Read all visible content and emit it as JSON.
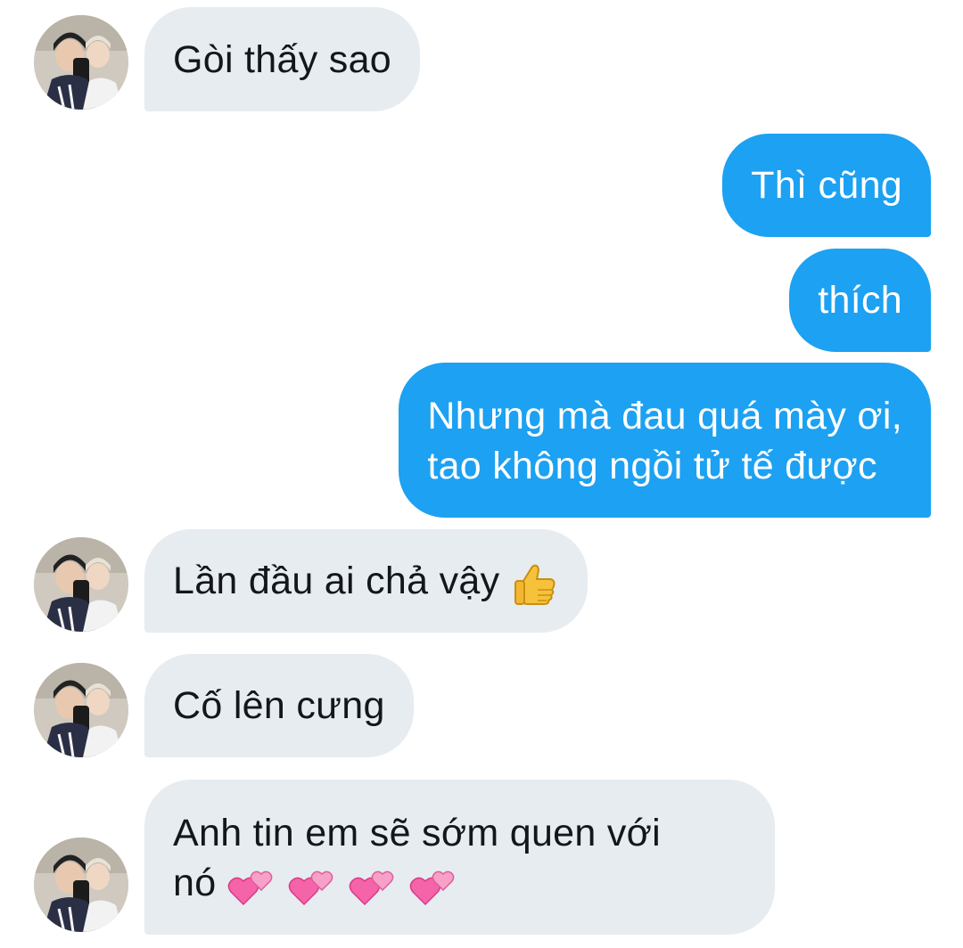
{
  "colors": {
    "incoming_bubble": "#e6ecf0",
    "outgoing_bubble": "#1da1f2",
    "incoming_text": "#14171a",
    "outgoing_text": "#ffffff"
  },
  "messages": [
    {
      "direction": "incoming",
      "text": "Gòi thấy sao",
      "avatar": "contact-avatar"
    },
    {
      "direction": "outgoing",
      "text": "Thì cũng"
    },
    {
      "direction": "outgoing",
      "text": "thích"
    },
    {
      "direction": "outgoing",
      "lines": [
        "Nhưng mà đau quá mày ơi,",
        "tao không ngồi tử tế được"
      ]
    },
    {
      "direction": "incoming",
      "text": "Lần đầu ai chả vậy",
      "emoji": [
        "thumbs-up-icon"
      ],
      "avatar": "contact-avatar"
    },
    {
      "direction": "incoming",
      "text": "Cố lên cưng",
      "avatar": "contact-avatar"
    },
    {
      "direction": "incoming",
      "lines": [
        "Anh tin em sẽ sớm quen với",
        "nó"
      ],
      "emoji": [
        "two-hearts-icon",
        "two-hearts-icon",
        "two-hearts-icon",
        "two-hearts-icon"
      ],
      "avatar": "contact-avatar"
    }
  ]
}
